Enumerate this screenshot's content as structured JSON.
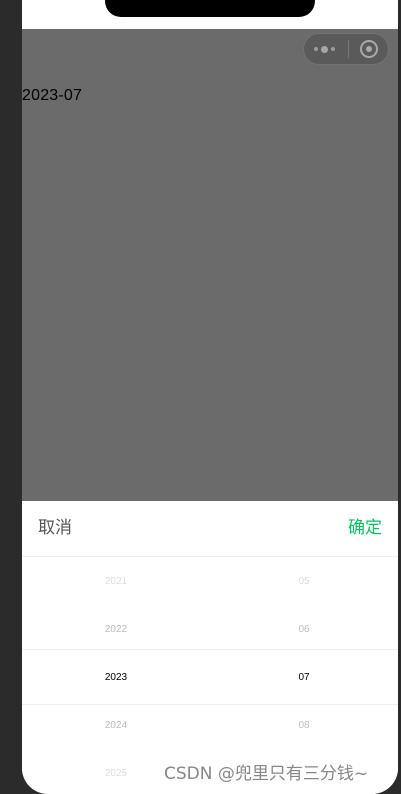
{
  "content": {
    "selected_date": "2023-07"
  },
  "capsule": {
    "more_icon": "more-dots-icon",
    "close_icon": "target-icon"
  },
  "picker": {
    "cancel_label": "取消",
    "confirm_label": "确定",
    "confirm_color": "#07c160",
    "years": [
      "2021",
      "2022",
      "2023",
      "2024",
      "2025"
    ],
    "months": [
      "05",
      "06",
      "07",
      "08"
    ],
    "selected_year": "2023",
    "selected_month": "07"
  },
  "watermark": "CSDN @兜里只有三分钱~"
}
